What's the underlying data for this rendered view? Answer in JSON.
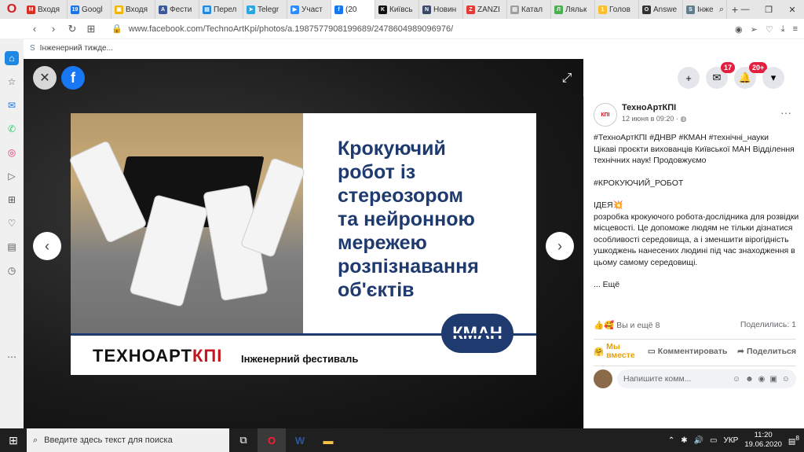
{
  "browser": {
    "tabs": [
      {
        "label": "Входя",
        "color": "#d93025",
        "glyph": "M"
      },
      {
        "label": "Googl",
        "color": "#1a73e8",
        "glyph": "19"
      },
      {
        "label": "Входя",
        "color": "#f4b400",
        "glyph": "▣"
      },
      {
        "label": "Фести",
        "color": "#3b5998",
        "glyph": "A"
      },
      {
        "label": "Перел",
        "color": "#1e88e5",
        "glyph": "▤"
      },
      {
        "label": "Telegr",
        "color": "#2ca5e0",
        "glyph": "➤"
      },
      {
        "label": "Участ",
        "color": "#2d8cff",
        "glyph": "▶"
      },
      {
        "label": "(20",
        "color": "#1877f2",
        "glyph": "f"
      },
      {
        "label": "Київсь",
        "color": "#111111",
        "glyph": "K"
      },
      {
        "label": "Новин",
        "color": "#3b4a6b",
        "glyph": "N"
      },
      {
        "label": "ZANZI",
        "color": "#e53935",
        "glyph": "Z"
      },
      {
        "label": "Катал",
        "color": "#9e9e9e",
        "glyph": "▤"
      },
      {
        "label": "Ляльк",
        "color": "#4caf50",
        "glyph": "Л"
      },
      {
        "label": "Голов",
        "color": "#fbc02d",
        "glyph": "1"
      },
      {
        "label": "Answe",
        "color": "#333333",
        "glyph": "O"
      },
      {
        "label": "Інже",
        "color": "#607d8b",
        "glyph": "S"
      }
    ],
    "url": "www.facebook.com/TechnoArtKpi/photos/a.1987577908199689/2478604989096976/",
    "bookmark": "Інженерний тижде..."
  },
  "viewer": {
    "poster_title": "Крокуючий\nробот із\nстереозором\nта нейронною\nмережею\nрозпізнавання\nоб'єктів",
    "kman": "КМАН",
    "logo_left": "ТЕХНОАРТ",
    "logo_right": "КПІ",
    "fest": "Інженерний фестиваль"
  },
  "header": {
    "messenger_badge": "17",
    "notif_badge": "20+"
  },
  "post": {
    "page_name": "ТехноАртКПІ",
    "avatar_text": "КПІ",
    "date": "12 июня в 09:20 · ◍",
    "hashtags": "#ТехноАртКПІ #ДНВР #КМАН #технічні_науки",
    "line1": "Цікаві проєкти вихованців Київської МАН Відділення технічних наук! Продовжуємо",
    "tag2": "#КРОКУЮЧИЙ_РОБОТ",
    "idea": "ІДЕЯ💥",
    "body": "розробка крокуючого робота-дослідника для розвідки місцевості. Це допоможе людям не тільки дізнатися особливості середовища, а і зменшити вірогідність ушкоджень нанесених людині під час знаходження в цьому самому середовищі.",
    "more": "... Ещё",
    "reactions": "Вы и ещё 8",
    "shares": "Поделились: 1",
    "action_like": "Мы вместе",
    "action_comment": "Комментировать",
    "action_share": "Поделиться",
    "comment_placeholder": "Напишите комм..."
  },
  "taskbar": {
    "search": "Введите здесь текст для поиска",
    "lang": "УКР",
    "time": "11:20",
    "date": "19.06.2020",
    "notif": "8"
  }
}
